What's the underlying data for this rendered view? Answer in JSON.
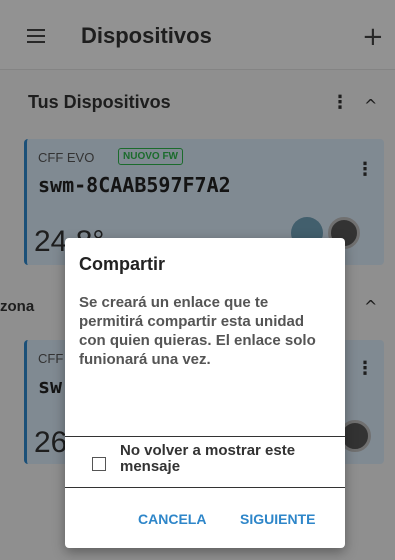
{
  "appbar": {
    "title": "Dispositivos",
    "menu_icon": "hamburger-icon",
    "add_icon": "plus-icon",
    "add_glyph": "+"
  },
  "section": {
    "title": "Tus Dispositivos",
    "menu_glyph": "⋮",
    "collapse_glyph": "^"
  },
  "devices": [
    {
      "model": "CFF EVO",
      "badge": "NUOVO FW",
      "name": "swm-8CAAB597F7A2",
      "temp": "24.8°"
    },
    {
      "model": "CFF",
      "name": "sw",
      "temp": "26"
    }
  ],
  "zone": {
    "title": "zona"
  },
  "dialog": {
    "title": "Compartir",
    "body": "Se creará un enlace que te permitirá compartir esta unidad con quien quieras. El enlace solo funionará una vez.",
    "checkbox_label": "No volver a mostrar este mensaje",
    "checkbox_checked": false,
    "cancel_label": "CANCELA",
    "next_label": "SIGUIENTE"
  },
  "colors": {
    "accent": "#2e86c9",
    "badge": "#2db34a",
    "card": "#d6e6f4"
  }
}
